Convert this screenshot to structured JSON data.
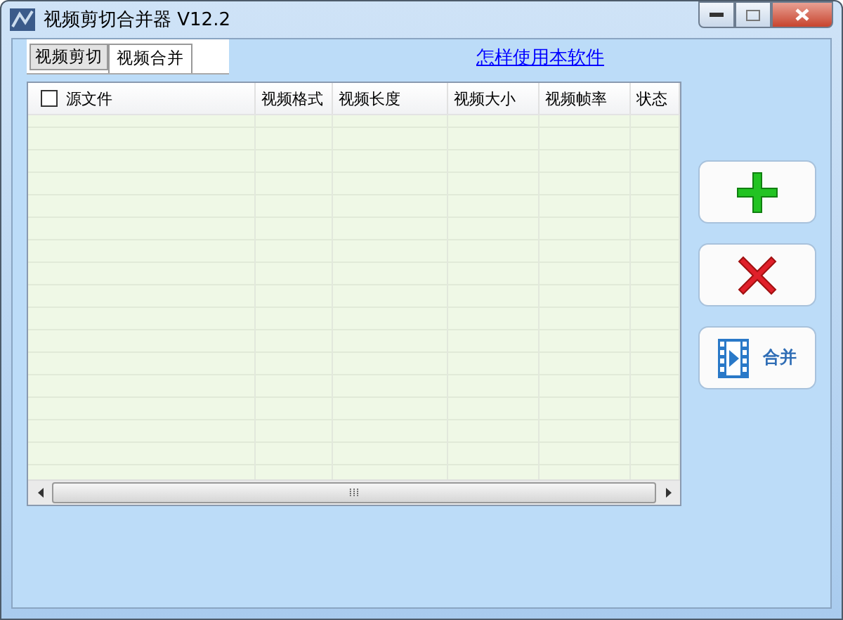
{
  "window": {
    "title": "视频剪切合并器 V12.2"
  },
  "tabs": [
    {
      "label": "视频剪切",
      "selected": false
    },
    {
      "label": "视频合并",
      "selected": true
    }
  ],
  "help_link": "怎样使用本软件",
  "table": {
    "select_all": {
      "checked": false
    },
    "columns": [
      "源文件",
      "视频格式",
      "视频长度",
      "视频大小",
      "视频帧率",
      "状态"
    ]
  },
  "buttons": [
    {
      "kind": "add"
    },
    {
      "kind": "delete"
    },
    {
      "kind": "merge",
      "label": "合并"
    }
  ],
  "scrollbar": {
    "grip": "⁞⁞⁞"
  }
}
